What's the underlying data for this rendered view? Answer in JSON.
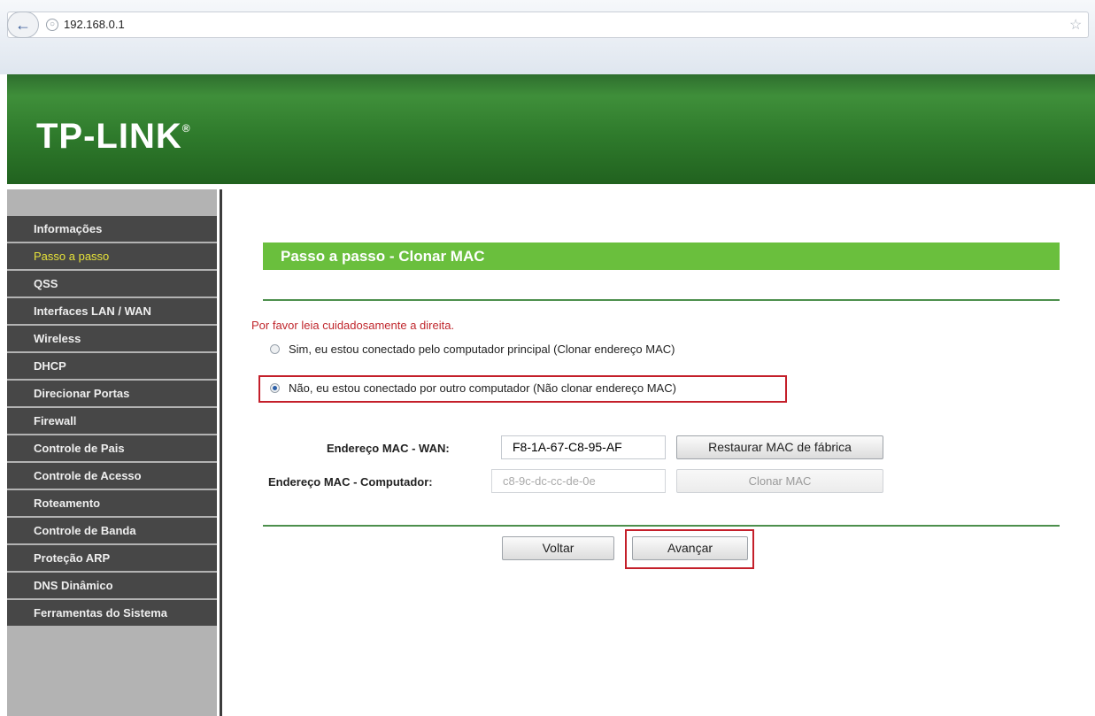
{
  "browser": {
    "url": "192.168.0.1"
  },
  "header": {
    "logo": "TP-LINK",
    "logo_mark": "®"
  },
  "sidebar": {
    "items": [
      {
        "label": "Informações",
        "active": false
      },
      {
        "label": "Passo a passo",
        "active": true
      },
      {
        "label": "QSS",
        "active": false
      },
      {
        "label": "Interfaces LAN / WAN",
        "active": false
      },
      {
        "label": "Wireless",
        "active": false
      },
      {
        "label": "DHCP",
        "active": false
      },
      {
        "label": "Direcionar Portas",
        "active": false
      },
      {
        "label": "Firewall",
        "active": false
      },
      {
        "label": "Controle de Pais",
        "active": false
      },
      {
        "label": "Controle de Acesso",
        "active": false
      },
      {
        "label": "Roteamento",
        "active": false
      },
      {
        "label": "Controle de Banda",
        "active": false
      },
      {
        "label": "Proteção ARP",
        "active": false
      },
      {
        "label": "DNS Dinâmico",
        "active": false
      },
      {
        "label": "Ferramentas do Sistema",
        "active": false
      }
    ]
  },
  "main": {
    "title": "Passo a passo - Clonar MAC",
    "warning": "Por favor leia cuidadosamente a direita.",
    "options": [
      {
        "label": "Sim, eu estou conectado pelo computador principal (Clonar endereço MAC)",
        "checked": false
      },
      {
        "label": "Não, eu estou conectado por outro computador (Não clonar endereço MAC)",
        "checked": true
      }
    ],
    "wan_mac_label": "Endereço MAC - WAN:",
    "wan_mac_value": "F8-1A-67-C8-95-AF",
    "restore_button": "Restaurar MAC de fábrica",
    "pc_mac_label": "Endereço MAC - Computador:",
    "pc_mac_value": "c8-9c-dc-cc-de-0e",
    "clone_button": "Clonar MAC",
    "back_button": "Voltar",
    "next_button": "Avançar"
  },
  "colors": {
    "header_green": "#2f7b2c",
    "title_green": "#6abf3d",
    "sidebar_item": "#474747",
    "active_item_text": "#e6e23a",
    "highlight_red": "#c41f2a",
    "warning_text": "#c0272d"
  }
}
